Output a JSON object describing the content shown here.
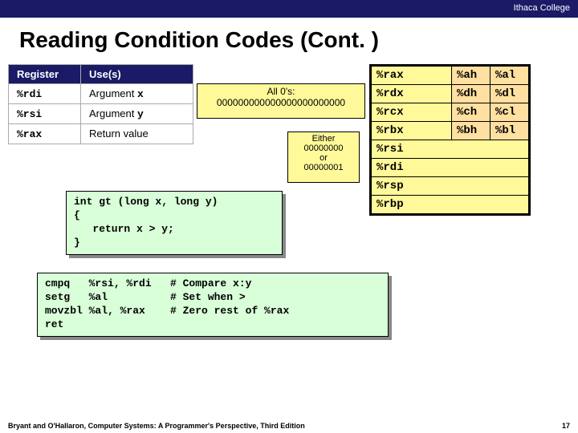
{
  "topbar": {
    "org": "Ithaca College"
  },
  "title": "Reading Condition Codes (Cont. )",
  "reg_table": {
    "headers": [
      "Register",
      "Use(s)"
    ],
    "rows": [
      {
        "reg": "%rdi",
        "use_prefix": "Argument ",
        "use_mono": "x"
      },
      {
        "reg": "%rsi",
        "use_prefix": "Argument ",
        "use_mono": "y"
      },
      {
        "reg": "%rax",
        "use_prefix": "Return value",
        "use_mono": ""
      }
    ]
  },
  "callout1": {
    "line1": "All 0's:",
    "line2": "000000000000000000000000"
  },
  "callout2": {
    "line1": "Either",
    "line2": "00000000",
    "line3": "or",
    "line4": "00000001"
  },
  "reg_grid": {
    "rows3": [
      {
        "a": "%rax",
        "b1": "%ah",
        "b2": "%al"
      },
      {
        "a": "%rdx",
        "b1": "%dh",
        "b2": "%dl"
      },
      {
        "a": "%rcx",
        "b1": "%ch",
        "b2": "%cl"
      },
      {
        "a": "%rbx",
        "b1": "%bh",
        "b2": "%bl"
      }
    ],
    "rows1": [
      "%rsi",
      "%rdi",
      "%rsp",
      "%rbp"
    ]
  },
  "code1": "int gt (long x, long y)\n{\n   return x > y;\n}",
  "code2": "cmpq   %rsi, %rdi   # Compare x:y\nsetg   %al          # Set when >\nmovzbl %al, %rax    # Zero rest of %rax\nret",
  "footer": {
    "left": "Bryant and O'Hallaron, Computer Systems: A Programmer's Perspective, Third Edition",
    "right": "17"
  }
}
